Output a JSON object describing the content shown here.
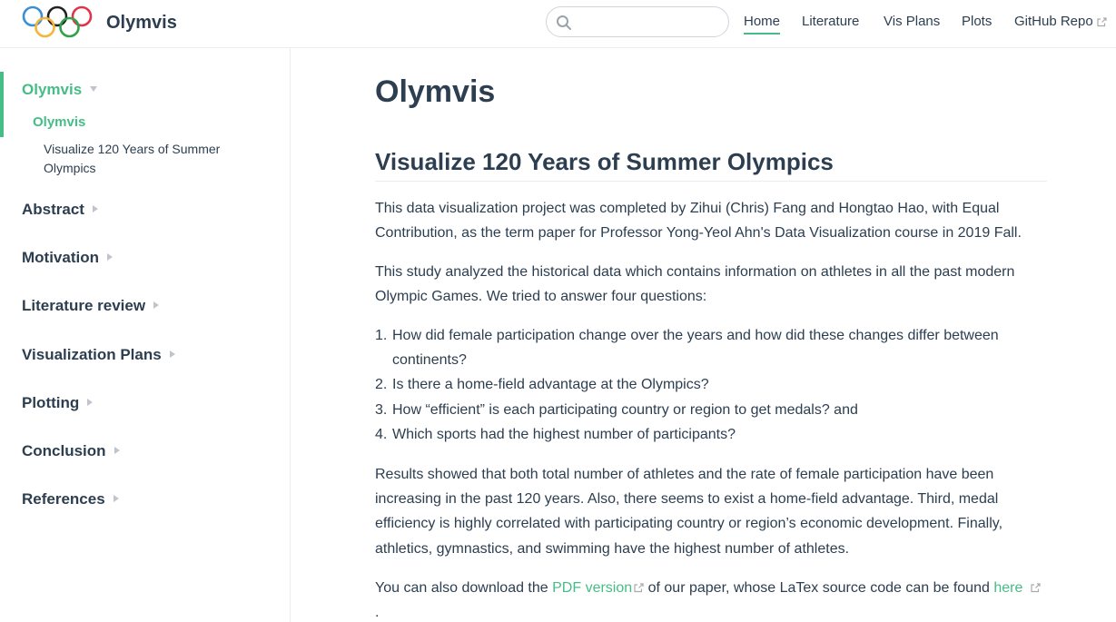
{
  "navbar": {
    "site_name": "Olymvis",
    "logo_icon": "olympic-rings-icon",
    "search": {
      "placeholder": "",
      "value": ""
    },
    "links": [
      {
        "label": "Home",
        "active": true,
        "external": false
      },
      {
        "label": "Literature",
        "active": false,
        "external": false
      },
      {
        "label": "Vis Plans",
        "active": false,
        "external": false
      },
      {
        "label": "Plots",
        "active": false,
        "external": false
      },
      {
        "label": "GitHub Repo",
        "active": false,
        "external": true
      }
    ]
  },
  "sidebar": {
    "groups": [
      {
        "label": "Olymvis",
        "expanded": true,
        "active": true
      },
      {
        "label": "Abstract",
        "expanded": false,
        "active": false
      },
      {
        "label": "Motivation",
        "expanded": false,
        "active": false
      },
      {
        "label": "Literature review",
        "expanded": false,
        "active": false
      },
      {
        "label": "Visualization Plans",
        "expanded": false,
        "active": false
      },
      {
        "label": "Plotting",
        "expanded": false,
        "active": false
      },
      {
        "label": "Conclusion",
        "expanded": false,
        "active": false
      },
      {
        "label": "References",
        "expanded": false,
        "active": false
      }
    ],
    "sub_item": "Olymvis",
    "sub_sub_item": "Visualize 120 Years of Summer Olympics"
  },
  "main": {
    "title": "Olymvis",
    "section_title": "Visualize 120 Years of Summer Olympics",
    "intro": "This data visualization project was completed by Zihui (Chris) Fang and Hongtao Hao, with Equal Contribution, as the term paper for Professor Yong-Yeol Ahn's Data Visualization course in 2019 Fall.",
    "study": "This study analyzed the historical data which contains information on athletes in all the past modern Olympic Games. We tried to answer four questions:",
    "questions": [
      "How did female participation change over the years and how did these changes differ between continents?",
      "Is there a home-field advantage at the Olympics?",
      "How “efficient” is each participating country or region to get medals? and",
      "Which sports had the highest number of participants?"
    ],
    "results": "Results showed that both total number of athletes and the rate of female participation have been increasing in the past 120 years. Also, there seems to exist a home-field advantage. Third, medal efficiency is highly correlated with participating country or region’s economic development. Finally, athletics, gymnastics, and swimming have the highest number of athletes.",
    "download_prefix": "You can also download the",
    "pdf_link": "PDF version",
    "download_middle": "of our paper, whose LaTex source code can be found",
    "here_link": "here",
    "download_suffix": "."
  },
  "colors": {
    "accent": "#46bd87",
    "text": "#2c3e50",
    "border": "#eaecef"
  }
}
